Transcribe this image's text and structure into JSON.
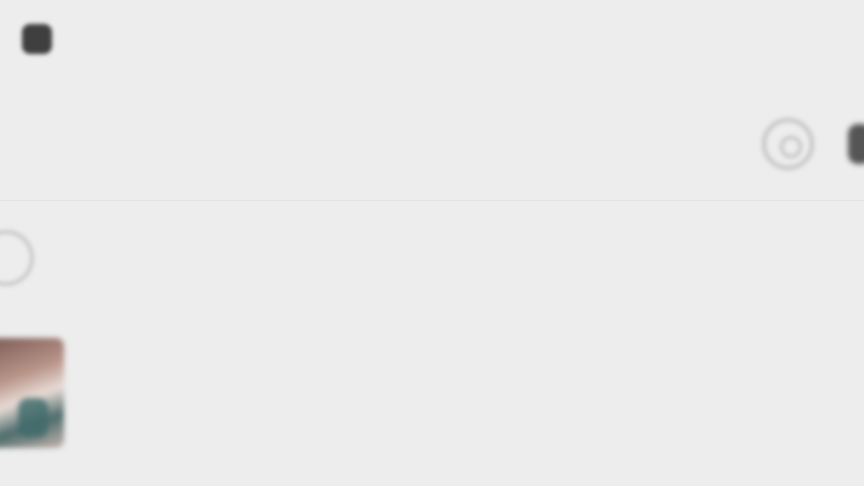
{
  "status_bar": {
    "time": "",
    "right_text": ""
  },
  "header": {
    "title": ""
  },
  "notice": {
    "text": ""
  },
  "chats": [
    {
      "name": "",
      "preview": "",
      "time": ""
    }
  ],
  "colors": {
    "background": "#ededed",
    "title_text": "#2a2a2a",
    "secondary_text": "#9d9d9d"
  },
  "icons": {
    "status_indicator": "square-dot-icon",
    "header_action": "circle-icon",
    "header_more": "more-icon",
    "notice": "info-circle-icon"
  }
}
